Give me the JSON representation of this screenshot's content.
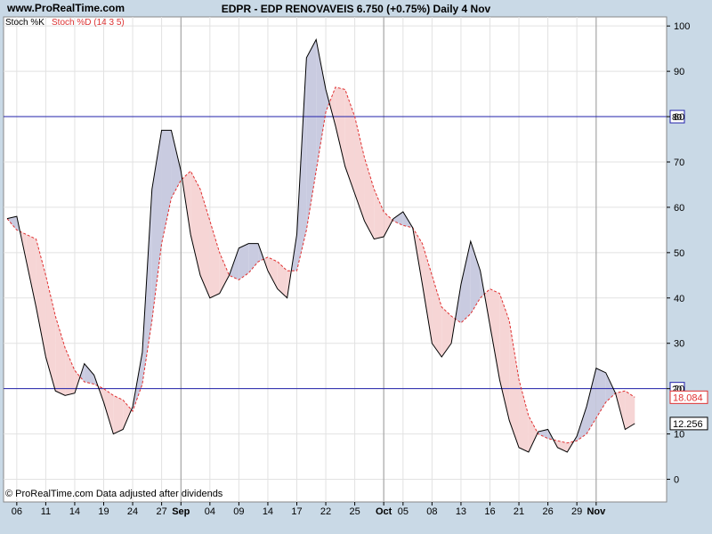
{
  "header": {
    "site": "www.ProRealTime.com",
    "title": "EDPR - EDP RENOVAVEIS    6.750 (+0.75%)    Daily  4 Nov"
  },
  "legend": {
    "k_label": "Stoch %K",
    "d_label": "Stoch %D (14 3 5)"
  },
  "footer": {
    "note": "© ProRealTime.com  Data adjusted after dividends"
  },
  "colors": {
    "k_line": "#000000",
    "d_line": "#e03030",
    "fill_k_above": "#c9cbe0",
    "fill_d_above": "#f6d5d5",
    "ref_line": "#2222aa",
    "background": "#ffffff",
    "grid": "#e2e2e2",
    "month_sep": "#999999"
  },
  "chart_data": {
    "type": "line",
    "title": "EDPR - EDP RENOVAVEIS    6.750 (+0.75%)    Daily  4 Nov",
    "ylim": [
      -5,
      102
    ],
    "yticks": [
      0,
      10,
      20,
      30,
      40,
      50,
      60,
      70,
      80,
      90,
      100
    ],
    "reference_lines": [
      {
        "value": 80,
        "label": "80"
      },
      {
        "value": 20,
        "label": "20"
      }
    ],
    "x_ticks": [
      {
        "i": 1,
        "label": "06"
      },
      {
        "i": 4,
        "label": "11"
      },
      {
        "i": 7,
        "label": "14"
      },
      {
        "i": 10,
        "label": "19"
      },
      {
        "i": 13,
        "label": "24"
      },
      {
        "i": 16,
        "label": "27"
      },
      {
        "i": 18,
        "label": "Sep",
        "bold": true
      },
      {
        "i": 21,
        "label": "04"
      },
      {
        "i": 24,
        "label": "09"
      },
      {
        "i": 27,
        "label": "14"
      },
      {
        "i": 30,
        "label": "17"
      },
      {
        "i": 33,
        "label": "22"
      },
      {
        "i": 36,
        "label": "25"
      },
      {
        "i": 39,
        "label": "Oct",
        "bold": true
      },
      {
        "i": 41,
        "label": "05"
      },
      {
        "i": 44,
        "label": "08"
      },
      {
        "i": 47,
        "label": "13"
      },
      {
        "i": 50,
        "label": "16"
      },
      {
        "i": 53,
        "label": "21"
      },
      {
        "i": 56,
        "label": "26"
      },
      {
        "i": 59,
        "label": "29"
      },
      {
        "i": 61,
        "label": "Nov",
        "bold": true
      }
    ],
    "month_separators": [
      18,
      39,
      61
    ],
    "x_range": [
      0,
      62
    ],
    "series": [
      {
        "name": "Stoch %K",
        "values": [
          57.5,
          58,
          48,
          38,
          27,
          19.5,
          18.5,
          19,
          25.5,
          23,
          17,
          10,
          11,
          16,
          28,
          64,
          77,
          77,
          68,
          54,
          45,
          40,
          41,
          45,
          51,
          52,
          52,
          46,
          42,
          40,
          54,
          93,
          97,
          86,
          78,
          69,
          63,
          57,
          53,
          53.5,
          57.5,
          59,
          55.5,
          43,
          30,
          27,
          30,
          43,
          52.5,
          46,
          34,
          22,
          13,
          7,
          6,
          10.5,
          11,
          7,
          6,
          9.5,
          16,
          24.5,
          23.5,
          19,
          11,
          12.3
        ]
      },
      {
        "name": "Stoch %D (14 3 5)",
        "values": [
          57.5,
          55,
          54,
          53,
          45,
          36,
          29,
          24,
          21.5,
          21,
          20,
          18.5,
          17.5,
          15,
          21,
          35,
          52,
          62,
          66,
          68,
          64,
          57,
          50,
          45,
          44,
          45.5,
          48,
          49,
          48,
          46,
          46,
          55,
          68,
          81,
          86.5,
          86,
          80,
          71,
          64,
          59,
          57,
          56,
          55.5,
          52,
          45,
          38,
          36,
          34.5,
          36.5,
          40,
          42,
          41,
          35,
          22,
          14,
          10,
          9,
          8.5,
          8,
          8.5,
          10,
          13.5,
          17,
          19,
          19.5,
          18.1
        ]
      }
    ],
    "last_values": {
      "k": "12.256",
      "d": "18.084"
    }
  }
}
